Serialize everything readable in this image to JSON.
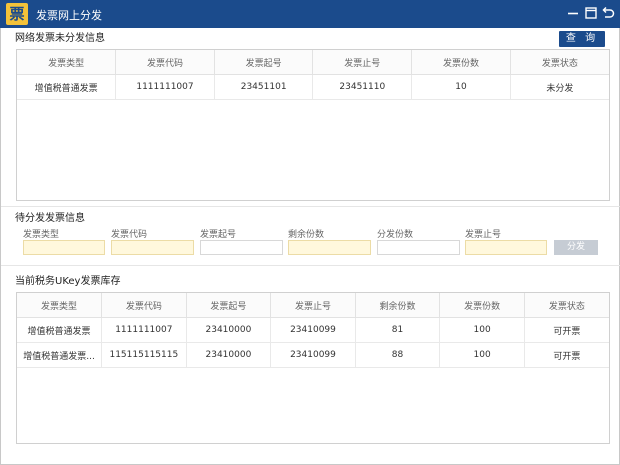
{
  "window": {
    "title": "发票网上分发",
    "logo_char": "票",
    "colors": {
      "titlebar": "#1b4b8c",
      "button": "#1b4b8c",
      "highlight_field": "#fff8dd"
    }
  },
  "network_section": {
    "title": "网络发票未分发信息",
    "query_label": "查 询",
    "columns": [
      "发票类型",
      "发票代码",
      "发票起号",
      "发票止号",
      "发票份数",
      "发票状态"
    ],
    "rows": [
      [
        "增值税普通发票",
        "1111111007",
        "23451101",
        "23451110",
        "10",
        "未分发"
      ]
    ]
  },
  "pending_section": {
    "title": "待分发发票信息",
    "fields": [
      {
        "label": "发票类型",
        "value": ""
      },
      {
        "label": "发票代码",
        "value": ""
      },
      {
        "label": "发票起号",
        "value": ""
      },
      {
        "label": "剩余份数",
        "value": ""
      },
      {
        "label": "分发份数",
        "value": ""
      },
      {
        "label": "发票止号",
        "value": ""
      }
    ],
    "distribute_label": "分发"
  },
  "stock_section": {
    "title": "当前税务UKey发票库存",
    "columns": [
      "发票类型",
      "发票代码",
      "发票起号",
      "发票止号",
      "剩余份数",
      "发票份数",
      "发票状态"
    ],
    "rows": [
      [
        "增值税普通发票",
        "1111111007",
        "23410000",
        "23410099",
        "81",
        "100",
        "可开票"
      ],
      [
        "增值税普通发票...",
        "115115115115",
        "23410000",
        "23410099",
        "88",
        "100",
        "可开票"
      ]
    ]
  }
}
